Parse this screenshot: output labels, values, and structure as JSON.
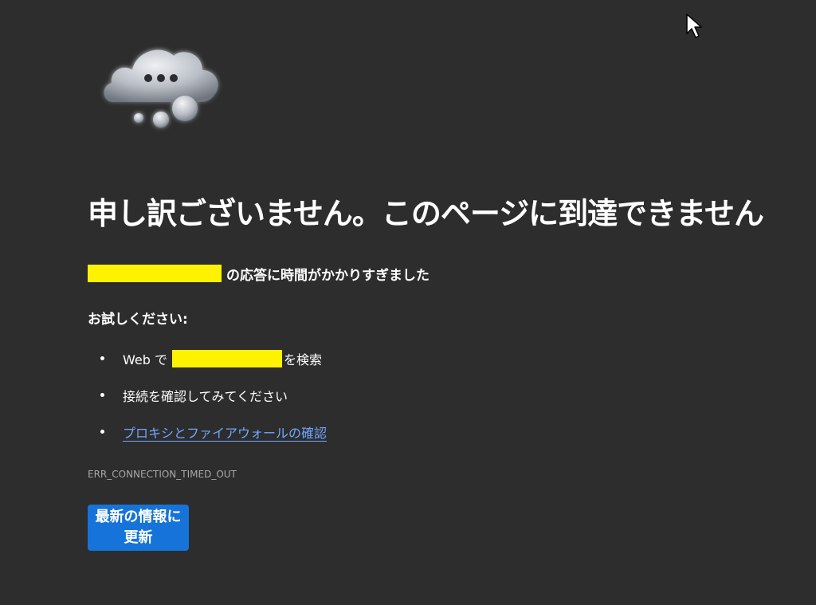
{
  "error": {
    "title": "申し訳ございません。このページに到達できません",
    "message_suffix": "の応答に時間がかかりすぎました",
    "try_heading": "お試しください:",
    "suggestions": {
      "search_prefix": "Web で",
      "search_suffix": "を検索",
      "check_connection": "接続を確認してみてください",
      "check_proxy_link": "プロキシとファイアウォールの確認"
    },
    "code": "ERR_CONNECTION_TIMED_OUT",
    "refresh_label": "最新の情報に更新"
  },
  "icons": {
    "hero": "cloud-thinking-icon",
    "pointer": "mouse-cursor-icon"
  },
  "colors": {
    "background": "#2d2d2d",
    "link": "#72a6ff",
    "button": "#1673d9",
    "redaction": "#fff200"
  }
}
